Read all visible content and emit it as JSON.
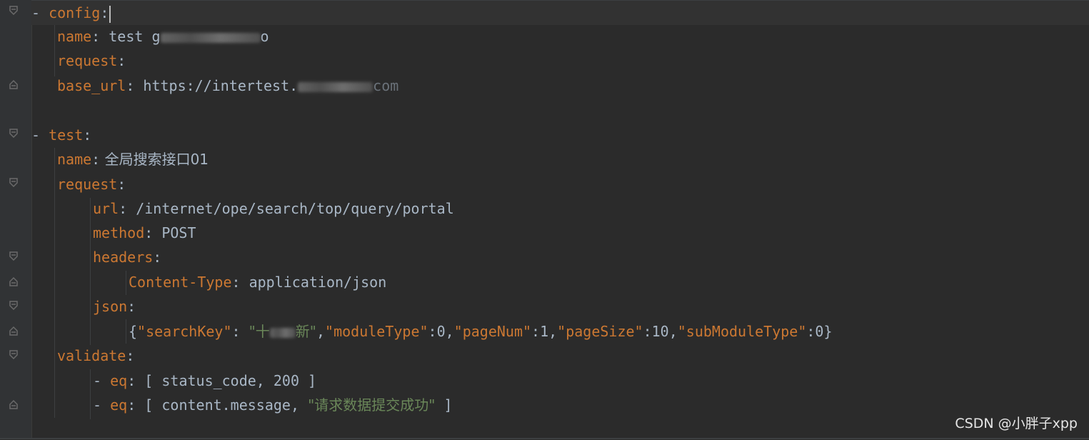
{
  "editor": {
    "lines": [
      {
        "id": "l1",
        "indent": 0,
        "dash": "- ",
        "key": "config",
        "colon": ":"
      },
      {
        "id": "l2",
        "indent": 2,
        "key": "name",
        "colon": ":",
        "value": " test g",
        "blur": "redacted"
      },
      {
        "id": "l3",
        "indent": 2,
        "key": "request",
        "colon": ":"
      },
      {
        "id": "l4",
        "indent": 2,
        "key": "base_url",
        "colon": ":",
        "value": " https://intertest.",
        "blur": "redacted"
      },
      {
        "id": "l5",
        "indent": 0
      },
      {
        "id": "l6",
        "indent": 0,
        "dash": "- ",
        "key": "test",
        "colon": ":"
      },
      {
        "id": "l7",
        "indent": 2,
        "key": "name",
        "colon": ":",
        "value": " 全局搜索接口01"
      },
      {
        "id": "l8",
        "indent": 2,
        "key": "request",
        "colon": ":"
      },
      {
        "id": "l9",
        "indent": 4,
        "key": "url",
        "colon": ":",
        "value": " /internet/ope/search/top/query/portal"
      },
      {
        "id": "l10",
        "indent": 4,
        "key": "method",
        "colon": ":",
        "value": " POST"
      },
      {
        "id": "l11",
        "indent": 4,
        "key": "headers",
        "colon": ":"
      },
      {
        "id": "l12",
        "indent": 6,
        "key": "Content-Type",
        "colon": ":",
        "value": " application/json"
      },
      {
        "id": "l13",
        "indent": 4,
        "key": "json",
        "colon": ":"
      },
      {
        "id": "l14",
        "indent": 6,
        "json_line": true
      },
      {
        "id": "l15",
        "indent": 2,
        "key": "validate",
        "colon": ":"
      },
      {
        "id": "l16",
        "indent": 4,
        "dash": "- ",
        "key": "eq",
        "colon": ":",
        "value": " [ status_code, 200 ]"
      },
      {
        "id": "l17",
        "indent": 4,
        "dash": "- ",
        "key": "eq",
        "colon": ":",
        "value_pre": " [ content.message, ",
        "value_str": "\"请求数据提交成功\"",
        "value_post": " ]"
      }
    ],
    "json_line": {
      "open": "{",
      "k1": "\"searchKey\"",
      "v1_pre": "\"十",
      "v1_post": "新\"",
      "k2": "\"moduleType\"",
      "v2": ":0,",
      "k3": "\"pageNum\"",
      "v3": ":1,",
      "k4": "\"pageSize\"",
      "v4": ":10,",
      "k5": "\"subModuleType\"",
      "v5": ":0}"
    },
    "l2_tail": "o",
    "l4_tail": "com"
  },
  "watermark": "CSDN @小胖子xpp",
  "colors": {
    "background": "#2b2b2b",
    "key": "#cc7832",
    "string": "#6a8759",
    "text": "#a9b7c6"
  }
}
